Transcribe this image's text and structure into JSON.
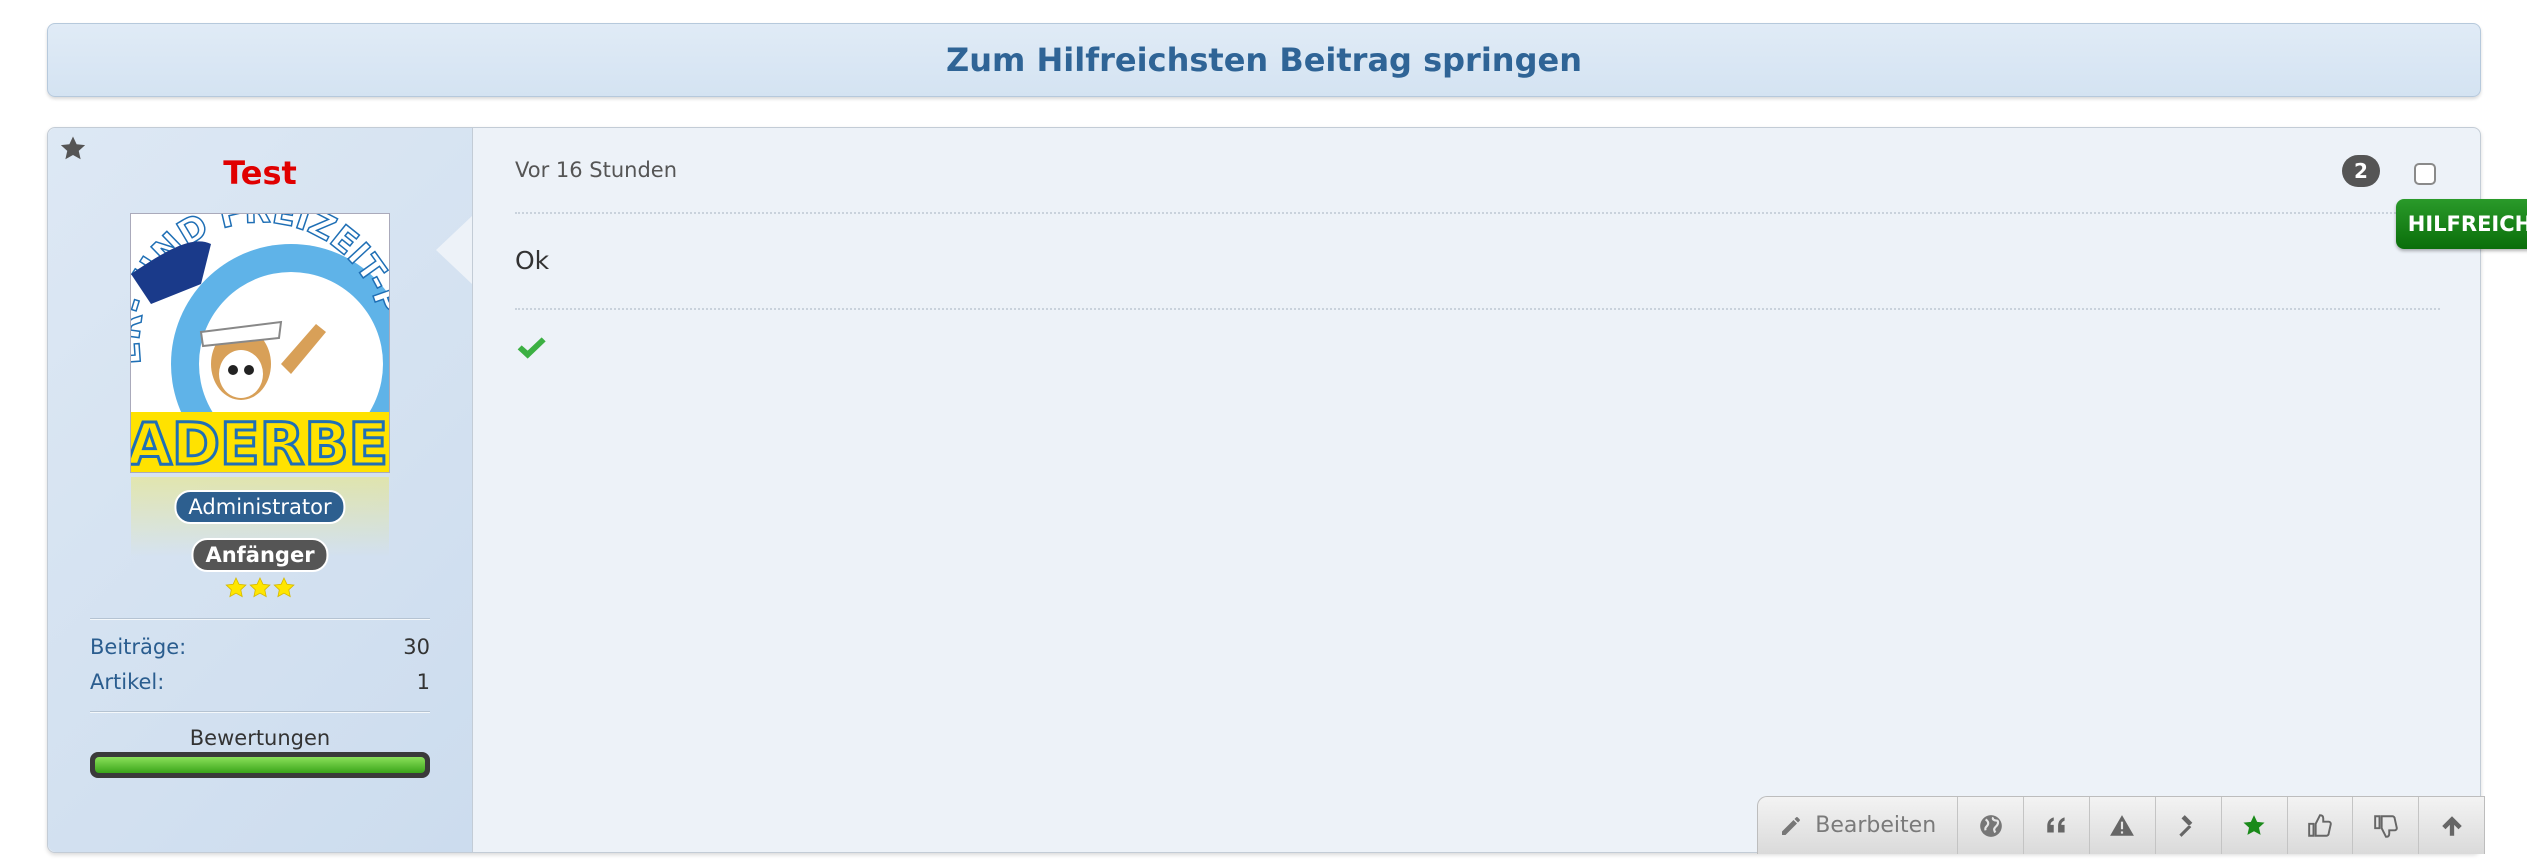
{
  "jump_bar": {
    "label": "Zum Hilfreichsten Beitrag springen"
  },
  "post": {
    "author": {
      "username": "Test",
      "username_color": "#e00000",
      "avatar_text": {
        "top": "ER- UND FREIZEIT-PARK",
        "bottom": "ADERBER"
      },
      "group_badge": "Administrator",
      "rank_badge": "Anfänger",
      "rank_stars": 3,
      "stats": [
        {
          "label": "Beiträge:",
          "value": "30"
        },
        {
          "label": "Artikel:",
          "value": "1"
        }
      ],
      "ratings_label": "Bewertungen",
      "ratings_fill": 1.0
    },
    "timestamp": "Vor 16 Stunden",
    "message": "Ok",
    "helpful_count": "2",
    "helpful_flag": "HILFREICH"
  },
  "toolbar": {
    "edit_label": "Bearbeiten",
    "buttons": [
      "pencil-icon",
      "globe-icon",
      "quote-icon",
      "warning-icon",
      "gavel-icon",
      "star-icon",
      "thumbs-up-icon",
      "thumbs-down-icon",
      "arrow-up-icon"
    ]
  },
  "colors": {
    "accent_blue": "#2f6496",
    "helpful_green": "#1a8a1a",
    "check_green": "#3cb043"
  }
}
